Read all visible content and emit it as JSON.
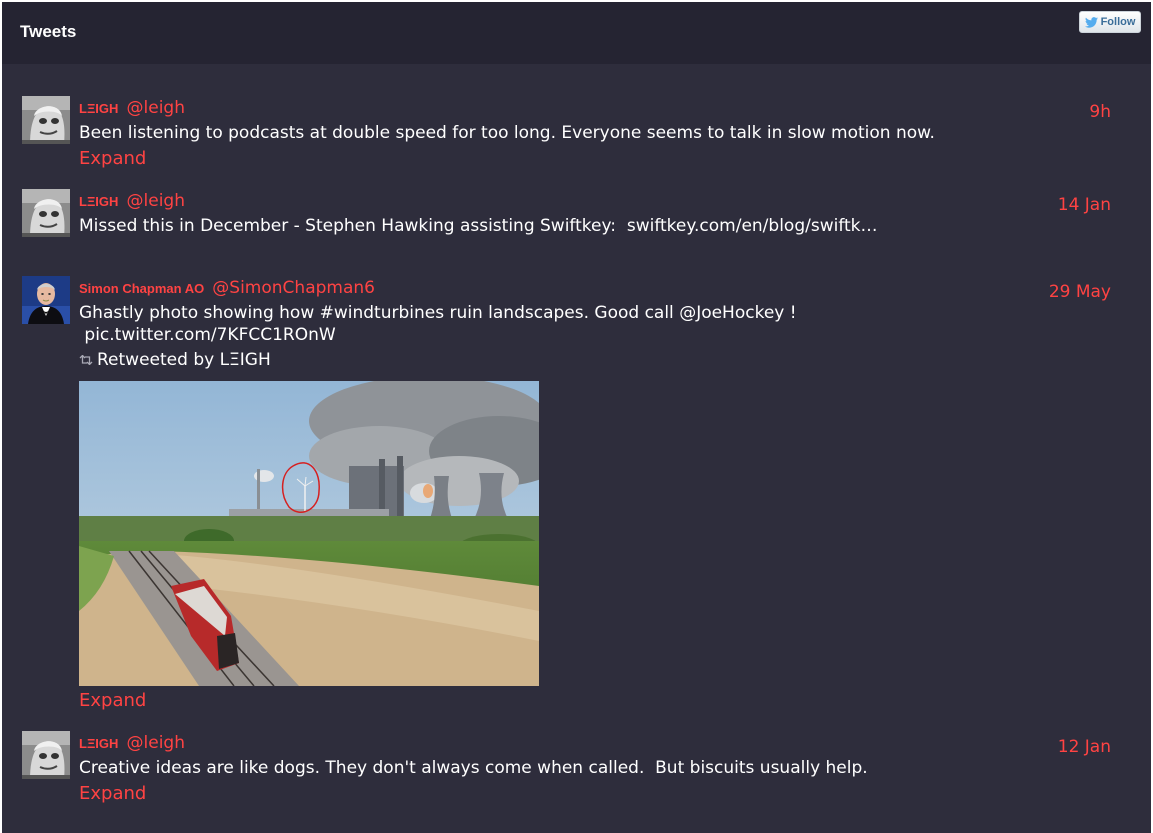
{
  "header": {
    "title": "Tweets",
    "follow_label": "Follow"
  },
  "colors": {
    "accent": "#ff4343",
    "background": "#2e2d3c",
    "header_background": "#252432",
    "text": "#ffffff"
  },
  "icons": {
    "follow": "twitter-bird-icon",
    "retweet": "retweet-icon"
  },
  "tweets": [
    {
      "author": "LΞIGH",
      "handle": "@leigh",
      "date": "9h",
      "text": "Been listening to podcasts at double speed for too long. Everyone seems to talk in slow motion now.",
      "expand": "Expand"
    },
    {
      "author": "LΞIGH",
      "handle": "@leigh",
      "date": "14 Jan",
      "text_prefix": "Missed this in December - Stephen Hawking assisting Swiftkey:  ",
      "link": "swiftkey.com/en/blog/swiftk…"
    },
    {
      "author": "Simon Chapman AO",
      "handle": "@SimonChapman6",
      "date": "29 May",
      "text": "Ghastly photo showing how #windturbines ruin landscapes. Good call @JoeHockey !",
      "link": " pic.twitter.com/7KFCC1ROnW",
      "retweeted_by": "Retweeted by LΞIGH",
      "expand": "Expand"
    },
    {
      "author": "LΞIGH",
      "handle": "@leigh",
      "date": "12 Jan",
      "text": "Creative ideas are like dogs. They don't always come when called.  But biscuits usually help.",
      "expand": "Expand"
    }
  ]
}
